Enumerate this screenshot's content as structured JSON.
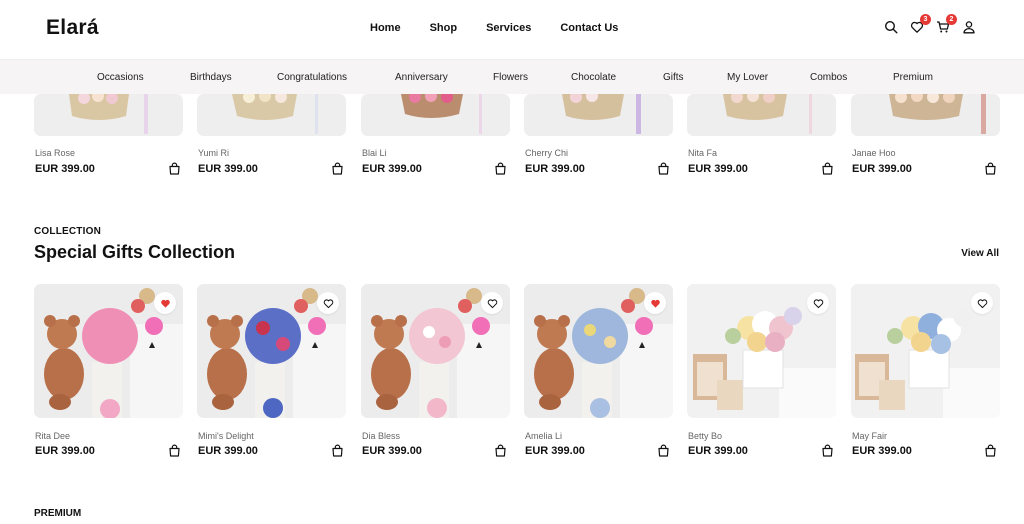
{
  "brand": "Elará",
  "nav": {
    "items": [
      "Home",
      "Shop",
      "Services",
      "Contact Us"
    ]
  },
  "header_icons": {
    "search": "search-icon",
    "wishlist": "heart-icon",
    "wishlist_count": "3",
    "cart": "cart-icon",
    "cart_count": "2",
    "account": "user-icon"
  },
  "categories": [
    "Occasions",
    "Birthdays",
    "Congratulations",
    "Anniversary",
    "Flowers",
    "Chocolate",
    "Gifts",
    "My Lover",
    "Combos",
    "Premium"
  ],
  "top_row": [
    {
      "name": "Lisa Rose",
      "price": "EUR 399.00"
    },
    {
      "name": "Yumi Ri",
      "price": "EUR 399.00"
    },
    {
      "name": "Blai Li",
      "price": "EUR 399.00"
    },
    {
      "name": "Cherry Chi",
      "price": "EUR 399.00"
    },
    {
      "name": "Nita Fa",
      "price": "EUR 399.00"
    },
    {
      "name": "Janae Hoo",
      "price": "EUR 399.00"
    }
  ],
  "collection": {
    "label": "COLLECTION",
    "title": "Special Gifts Collection",
    "view_all": "View All",
    "items": [
      {
        "name": "Rita Dee",
        "price": "EUR 399.00",
        "favorited": true
      },
      {
        "name": "Mimi's Delight",
        "price": "EUR 399.00",
        "favorited": false
      },
      {
        "name": "Dia Bless",
        "price": "EUR 399.00",
        "favorited": false
      },
      {
        "name": "Amelia Li",
        "price": "EUR 399.00",
        "favorited": true
      },
      {
        "name": "Betty Bo",
        "price": "EUR 399.00",
        "favorited": false
      },
      {
        "name": "May Fair",
        "price": "EUR 399.00",
        "favorited": false
      }
    ]
  },
  "premium_label": "PREMIUM",
  "colors": {
    "accent_red": "#e53935",
    "page_bg": "#ffffff",
    "category_bar_bg": "#f6f4f4"
  }
}
